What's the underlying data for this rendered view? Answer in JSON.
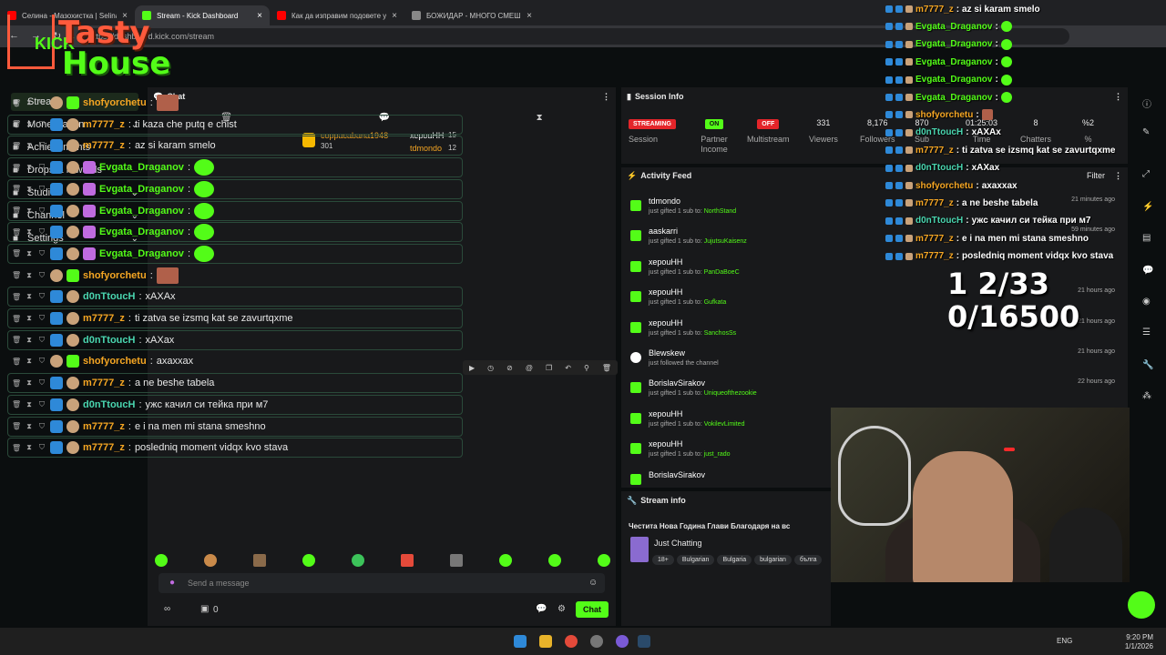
{
  "browser": {
    "tabs": [
      {
        "title": "Селина - Мазохистка | Selina",
        "color": "#ff0000"
      },
      {
        "title": "Stream - Kick Dashboard",
        "color": "#53fc18"
      },
      {
        "title": "Как да изправим подовете у д",
        "color": "#ff0000"
      },
      {
        "title": "БОЖИДАР - МНОГО СМЕШНО",
        "color": "#888888"
      }
    ],
    "url": "https://dashboard.kick.com/stream"
  },
  "logo": {
    "line1": "Tasty",
    "line2": "House",
    "kick": "KICK"
  },
  "nav": [
    {
      "label": "Stream",
      "icon": "stream-icon",
      "chevron": false
    },
    {
      "label": "Monetization",
      "icon": "dollar-icon",
      "chevron": true
    },
    {
      "label": "Achievements",
      "icon": "trophy-icon",
      "chevron": false
    },
    {
      "label": "Drops & rewards",
      "icon": "gift-icon",
      "chevron": false
    },
    {
      "label": "Studio",
      "icon": "studio-icon",
      "chevron": true
    },
    {
      "label": "Channel",
      "icon": "channel-icon",
      "chevron": true
    },
    {
      "label": "Settings",
      "icon": "gear-icon",
      "chevron": true
    }
  ],
  "chat": {
    "title": "Chat",
    "pinned": {
      "rank1": {
        "name": "coppacabana1948",
        "count": "301"
      },
      "rank2": {
        "name": "хероuHH",
        "count": "15"
      },
      "rank3": {
        "name": "tdmondo",
        "count": "12"
      }
    },
    "messages": [
      {
        "user": "shofyorchetu",
        "text": "",
        "color": "or",
        "emote": "face",
        "boxed": false
      },
      {
        "user": "m7777_z",
        "text": "ti kaza che putq e chist",
        "color": "or",
        "emote": "",
        "boxed": true
      },
      {
        "user": "m7777_z",
        "text": "az si karam smelo",
        "color": "or",
        "emote": "",
        "boxed": true
      },
      {
        "user": "Evgata_Draganov",
        "text": "",
        "color": "gr",
        "emote": "green",
        "boxed": true
      },
      {
        "user": "Evgata_Draganov",
        "text": "",
        "color": "gr",
        "emote": "green",
        "boxed": true
      },
      {
        "user": "Evgata_Draganov",
        "text": "",
        "color": "gr",
        "emote": "green",
        "boxed": true
      },
      {
        "user": "Evgata_Draganov",
        "text": "",
        "color": "gr",
        "emote": "green",
        "boxed": true
      },
      {
        "user": "Evgata_Draganov",
        "text": "",
        "color": "gr",
        "emote": "green",
        "boxed": true
      },
      {
        "user": "shofyorchetu",
        "text": "",
        "color": "or",
        "emote": "face",
        "boxed": false
      },
      {
        "user": "d0nTtoucH",
        "text": "xAXAx",
        "color": "aq",
        "emote": "",
        "boxed": true
      },
      {
        "user": "m7777_z",
        "text": "ti zatva se izsmq kat se zavurtqxme",
        "color": "or",
        "emote": "",
        "boxed": true
      },
      {
        "user": "d0nTtoucH",
        "text": "xAXax",
        "color": "aq",
        "emote": "",
        "boxed": true
      },
      {
        "user": "shofyorchetu",
        "text": "axaxxax",
        "color": "or",
        "emote": "",
        "boxed": false
      },
      {
        "user": "m7777_z",
        "text": "a ne beshe tabela",
        "color": "or",
        "emote": "",
        "boxed": true
      },
      {
        "user": "d0nTtoucH",
        "text": "ужс качил си тейка при м7",
        "color": "aq",
        "emote": "",
        "boxed": true
      },
      {
        "user": "m7777_z",
        "text": "e i na men mi stana smeshno",
        "color": "or",
        "emote": "",
        "boxed": true
      },
      {
        "user": "m7777_z",
        "text": "posledniq moment vidqx kvo stava",
        "color": "or",
        "emote": "",
        "boxed": true
      }
    ],
    "input_placeholder": "Send a message",
    "send_label": "Chat",
    "footer_count": "0"
  },
  "session": {
    "title": "Session Info",
    "streaming": "STREAMING",
    "on": "ON",
    "off": "OFF",
    "labels": {
      "session": "Session",
      "partner": "Partner Income",
      "multistream": "Multistream",
      "viewers": "Viewers",
      "followers": "Followers",
      "sub": "Sub",
      "time": "Time",
      "chatters": "Chatters",
      "pct": "%"
    },
    "values": {
      "viewers": "331",
      "followers": "8,176",
      "sub": "870",
      "time": "01:25:03",
      "chatters": "8",
      "pct": "%2"
    }
  },
  "activity": {
    "title": "Activity Feed",
    "filter": "Filter",
    "items": [
      {
        "name": "tdmondo",
        "sub": "just gifted 1 sub to:",
        "target": "NorthStand",
        "ago": "21 minutes ago",
        "icon": "gift-icon"
      },
      {
        "name": "aaskarri",
        "sub": "just gifted 1 sub to:",
        "target": "JujutsuKaisenz",
        "ago": "59 minutes ago",
        "icon": "gift-icon"
      },
      {
        "name": "хероuHH",
        "sub": "just gifted 1 sub to:",
        "target": "PanDaBoeC",
        "ago": "",
        "icon": "gift-icon"
      },
      {
        "name": "хероuHH",
        "sub": "just gifted 1 sub to:",
        "target": "Gufkata",
        "ago": "21 hours ago",
        "icon": "gift-icon"
      },
      {
        "name": "хероuHH",
        "sub": "just gifted 1 sub to:",
        "target": "SanchosSs",
        "ago": "21 hours ago",
        "icon": "gift-icon"
      },
      {
        "name": "Blewskew",
        "sub": "just followed the channel",
        "target": "",
        "ago": "21 hours ago",
        "icon": "heart-icon"
      },
      {
        "name": "BorislavSirakov",
        "sub": "just gifted 1 sub to:",
        "target": "Uniqueofthezookie",
        "ago": "22 hours ago",
        "icon": "gift-icon"
      },
      {
        "name": "хероuHH",
        "sub": "just gifted 1 sub to:",
        "target": "VokilevLimited",
        "ago": "",
        "icon": "gift-icon"
      },
      {
        "name": "хероuHH",
        "sub": "just gifted 1 sub to:",
        "target": "just_rado",
        "ago": "",
        "icon": "gift-icon"
      },
      {
        "name": "BorislavSirakov",
        "sub": "",
        "target": "",
        "ago": "",
        "icon": "gift-icon"
      }
    ]
  },
  "stream_info": {
    "title": "Stream info",
    "stream_title": "Честита Нова Година Глави  Благодаря на вс",
    "category": "Just Chatting",
    "tags": [
      "18+",
      "Bulgarian",
      "Bulgaria",
      "bulgarian",
      "бълга"
    ]
  },
  "overlay": {
    "lines": [
      {
        "user": "m7777_z",
        "text": "az si karam smelo",
        "color": "#f5a623"
      },
      {
        "user": "Evgata_Draganov",
        "text": "",
        "color": "#53fc18"
      },
      {
        "user": "Evgata_Draganov",
        "text": "",
        "color": "#53fc18"
      },
      {
        "user": "Evgata_Draganov",
        "text": "",
        "color": "#53fc18"
      },
      {
        "user": "Evgata_Draganov",
        "text": "",
        "color": "#53fc18"
      },
      {
        "user": "Evgata_Draganov",
        "text": "",
        "color": "#53fc18"
      },
      {
        "user": "shofyorchetu",
        "text": "",
        "color": "#f5a623"
      },
      {
        "user": "d0nTtoucH",
        "text": "xAXAx",
        "color": "#4ad6b0"
      },
      {
        "user": "m7777_z",
        "text": "ti zatva se izsmq kat se zavurtqxme",
        "color": "#f5a623"
      },
      {
        "user": "d0nTtoucH",
        "text": "xAXax",
        "color": "#4ad6b0"
      },
      {
        "user": "shofyorchetu",
        "text": "axaxxax",
        "color": "#f5a623"
      },
      {
        "user": "m7777_z",
        "text": "a ne beshe tabela",
        "color": "#f5a623"
      },
      {
        "user": "d0nTtoucH",
        "text": "ужс качил си тейка при м7",
        "color": "#4ad6b0"
      },
      {
        "user": "m7777_z",
        "text": "e i na men mi stana smeshno",
        "color": "#f5a623"
      },
      {
        "user": "m7777_z",
        "text": "posledniq moment vidqx kvo stava",
        "color": "#f5a623"
      }
    ],
    "goal_line1": "1 2/33",
    "goal_line2": "0/16500"
  },
  "taskbar": {
    "lang": "ENG",
    "time": "9:20 PM",
    "date": "1/1/2026"
  }
}
